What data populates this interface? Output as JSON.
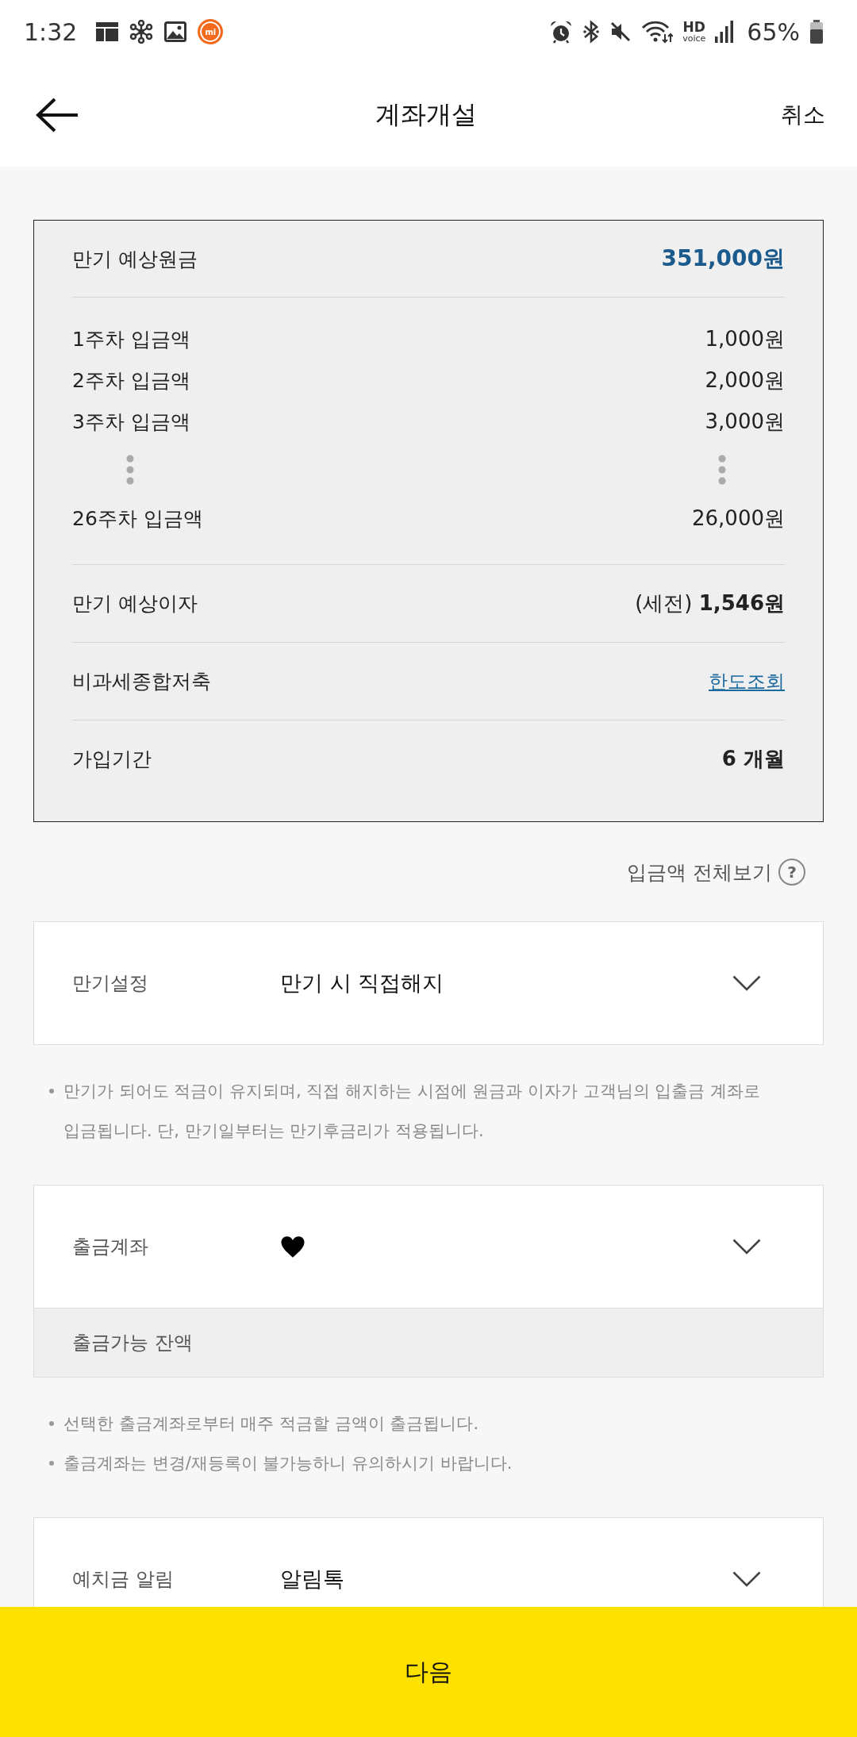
{
  "status_bar": {
    "time": "1:32",
    "app_logo": "mi",
    "hd": "HD",
    "voice": "voice",
    "battery": "65%"
  },
  "header": {
    "title": "계좌개설",
    "cancel": "취소"
  },
  "summary": {
    "principal": {
      "label": "만기 예상원금",
      "value": "351,000원"
    },
    "deposits": [
      {
        "kind": "amount",
        "label": "1주차 입금액",
        "value": "1,000원"
      },
      {
        "kind": "amount",
        "label": "2주차 입금액",
        "value": "2,000원"
      },
      {
        "kind": "amount",
        "label": "3주차 입금액",
        "value": "3,000원"
      },
      {
        "kind": "ellipsis"
      },
      {
        "kind": "amount",
        "label": "26주차 입금액",
        "value": "26,000원"
      }
    ],
    "interest": {
      "label": "만기 예상이자",
      "value": "(세전) **1,546원**"
    },
    "tax_free": {
      "label": "비과세종합저축",
      "link": "한도조회"
    },
    "period": {
      "label": "가입기간",
      "value": "6 개월"
    }
  },
  "view_all": {
    "label": "입금액 전체보기",
    "help": "?"
  },
  "sections": [
    {
      "kind": "select",
      "label": "만기설정",
      "value": "만기 시 직접해지",
      "notes": [
        "만기가 되어도 적금이 유지되며, 직접 해지하는 시점에 원금과 이자가 고객님의 입출금 계좌로 입금됩니다. 단, 만기일부터는 만기후금리가 적용됩니다."
      ]
    },
    {
      "kind": "account",
      "label": "출금계좌",
      "balance_label": "출금가능 잔액",
      "notes": [
        "선택한 출금계좌로부터 매주 적금할 금액이 출금됩니다.",
        "출금계좌는 변경/재등록이 불가능하니 유의하시기 바랍니다."
      ]
    },
    {
      "kind": "select",
      "label": "예치금 알림",
      "value": "알림톡"
    }
  ],
  "next_button": "다음"
}
